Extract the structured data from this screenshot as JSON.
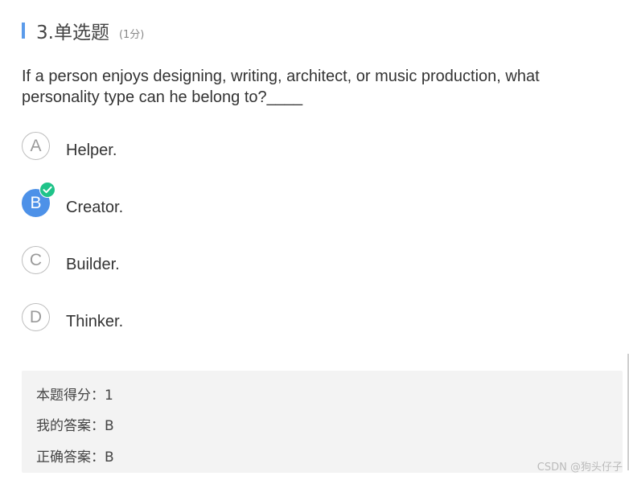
{
  "question": {
    "title": "3.单选题",
    "score": "(1分)",
    "text": "If a person enjoys designing, writing, architect, or music production, what personality type can he belong to?____"
  },
  "options": [
    {
      "letter": "A",
      "label": "Helper.",
      "selected": false
    },
    {
      "letter": "B",
      "label": "Creator.",
      "selected": true
    },
    {
      "letter": "C",
      "label": "Builder.",
      "selected": false
    },
    {
      "letter": "D",
      "label": "Thinker.",
      "selected": false
    }
  ],
  "result": {
    "score_line": "本题得分：1",
    "my_answer_line": "我的答案：B",
    "correct_answer_line": "正确答案：B"
  },
  "watermark": "CSDN @狗头仔子",
  "colors": {
    "accent_bar": "#5b9bea",
    "selected_option": "#4d91e8",
    "check_badge": "#1fc389",
    "result_background": "#f3f3f3"
  },
  "icons": {
    "selected_check": "check-icon"
  }
}
